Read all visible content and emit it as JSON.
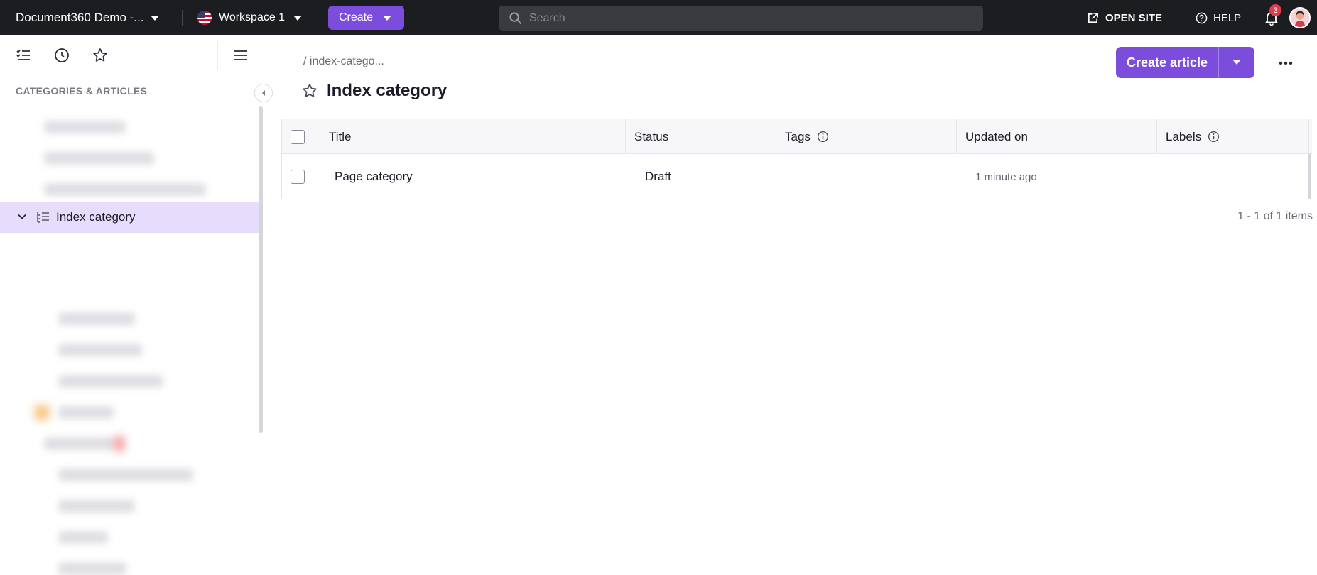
{
  "topbar": {
    "project_name": "Document360 Demo -...",
    "workspace": "Workspace 1",
    "create_label": "Create",
    "search_placeholder": "Search",
    "open_site_label": "OPEN SITE",
    "help_label": "HELP",
    "notification_count": "3"
  },
  "sidebar": {
    "heading": "CATEGORIES & ARTICLES",
    "active_item": "Index category"
  },
  "main": {
    "breadcrumb": "/ index-catego...",
    "title": "Index category",
    "create_article_label": "Create article",
    "table": {
      "columns": [
        "Title",
        "Status",
        "Tags",
        "Updated on",
        "Labels"
      ],
      "rows": [
        {
          "title": "Page category",
          "status": "Draft",
          "tags": "",
          "updated_on": "1 minute ago",
          "labels": ""
        }
      ]
    },
    "pagination": "1 - 1 of 1 items"
  },
  "colors": {
    "accent": "#7c4ddc",
    "topbar_bg": "#1c1d21",
    "active_row_bg": "#e6dcfb",
    "badge": "#e23b4e"
  },
  "icons": [
    "search-icon",
    "external-link-icon",
    "help-icon",
    "bell-icon",
    "checklist-icon",
    "clock-icon",
    "star-icon",
    "menu-icon",
    "chevron-left-icon",
    "chevron-down-icon",
    "index-category-icon",
    "info-icon",
    "more-icon",
    "caret-down-icon"
  ]
}
